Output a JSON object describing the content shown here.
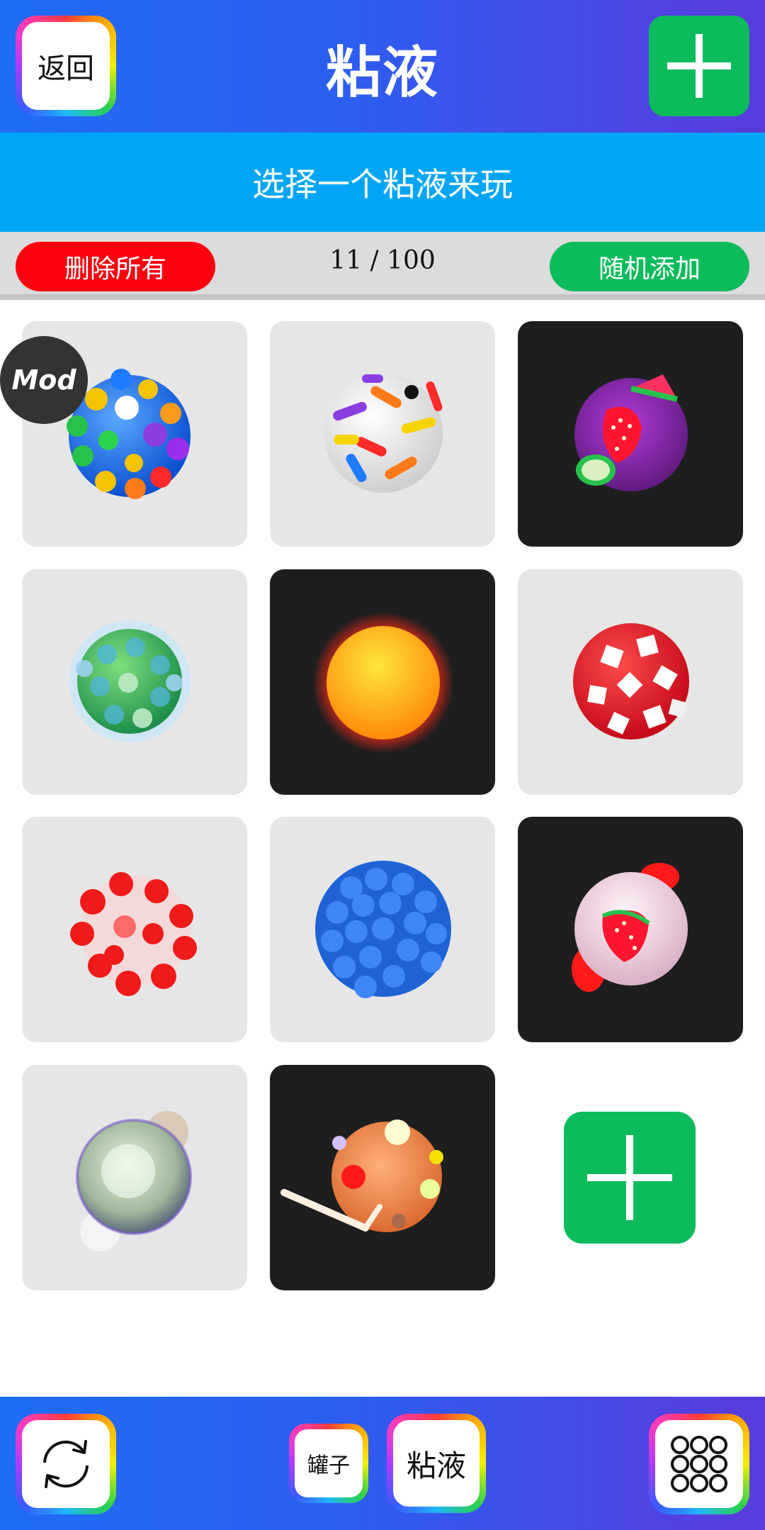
{
  "header": {
    "back_label": "返回",
    "title": "粘液",
    "add_icon": "plus-icon"
  },
  "subtitle": "选择一个粘液来玩",
  "controls": {
    "delete_all_label": "删除所有",
    "counter": "11 / 100",
    "random_add_label": "随机添加"
  },
  "mod_badge": "Mod",
  "slimes": [
    {
      "name": "blue-gumball-slime",
      "theme": "light"
    },
    {
      "name": "sprinkle-slime",
      "theme": "light"
    },
    {
      "name": "fruit-glow-slime",
      "theme": "dark"
    },
    {
      "name": "green-bubble-slime",
      "theme": "light"
    },
    {
      "name": "sun-glow-slime",
      "theme": "dark"
    },
    {
      "name": "red-white-cube-slime",
      "theme": "light"
    },
    {
      "name": "red-bead-slime",
      "theme": "light"
    },
    {
      "name": "blue-foam-slime",
      "theme": "light"
    },
    {
      "name": "strawberry-glow-slime",
      "theme": "dark"
    },
    {
      "name": "pearl-bubble-slime",
      "theme": "light"
    },
    {
      "name": "orange-orb-slime",
      "theme": "dark"
    }
  ],
  "footer": {
    "refresh_icon": "refresh-icon",
    "jar_label": "罐子",
    "slime_label": "粘液",
    "grid_icon": "grid-icon"
  },
  "colors": {
    "header_blue": "#1f6cf5",
    "header_purple": "#5a3bdc",
    "subtitle_band": "#00a6f5",
    "delete_red": "#ff0010",
    "add_green": "#0cbb5c"
  }
}
